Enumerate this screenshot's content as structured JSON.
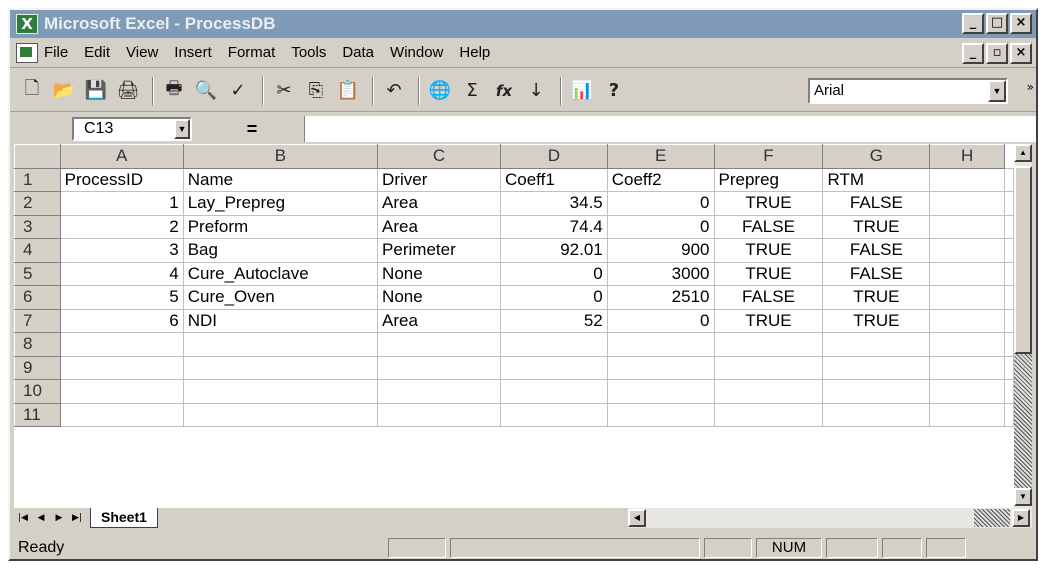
{
  "window": {
    "title": "Microsoft Excel - ProcessDB",
    "app_icon_glyph": "X",
    "controls": [
      "_",
      "□",
      "×"
    ]
  },
  "menubar": {
    "items": [
      "File",
      "Edit",
      "View",
      "Insert",
      "Format",
      "Tools",
      "Data",
      "Window",
      "Help"
    ],
    "controls": [
      "_",
      "▫",
      "×"
    ]
  },
  "toolbar": {
    "icons": [
      {
        "name": "new-icon",
        "glyph": "🗋"
      },
      {
        "name": "open-icon",
        "glyph": "📂"
      },
      {
        "name": "save-icon",
        "glyph": "💾"
      },
      {
        "name": "print-preview-icon",
        "glyph": "🖨"
      },
      {
        "name": "print-icon",
        "glyph": "🖶"
      },
      {
        "name": "preview-icon",
        "glyph": "🔍"
      },
      {
        "name": "spelling-icon",
        "glyph": "✓"
      },
      {
        "name": "cut-icon",
        "glyph": "✂"
      },
      {
        "name": "copy-icon",
        "glyph": "⎘"
      },
      {
        "name": "paste-icon",
        "glyph": "📋"
      },
      {
        "name": "undo-icon",
        "glyph": "↶"
      },
      {
        "name": "hyperlink-icon",
        "glyph": "🌐"
      },
      {
        "name": "autosum-icon",
        "glyph": "Σ"
      },
      {
        "name": "function-icon",
        "glyph": "fx"
      },
      {
        "name": "sort-icon",
        "glyph": "↓"
      },
      {
        "name": "chart-wizard-icon",
        "glyph": "📊"
      },
      {
        "name": "help-icon",
        "glyph": "?"
      }
    ],
    "font": "Arial",
    "more_glyph": "»"
  },
  "formula_bar": {
    "name_box": "C13",
    "equals": "=",
    "formula": ""
  },
  "grid": {
    "columns": [
      "A",
      "B",
      "C",
      "D",
      "E",
      "F",
      "G",
      "H"
    ],
    "rows": [
      {
        "n": "1",
        "cells": [
          "ProcessID",
          "Name",
          "Driver",
          "Coeff1",
          "Coeff2",
          "Prepreg",
          "RTM",
          ""
        ]
      },
      {
        "n": "2",
        "cells": [
          "1",
          "Lay_Prepreg",
          "Area",
          "34.5",
          "0",
          "TRUE",
          "FALSE",
          ""
        ]
      },
      {
        "n": "3",
        "cells": [
          "2",
          "Preform",
          "Area",
          "74.4",
          "0",
          "FALSE",
          "TRUE",
          ""
        ]
      },
      {
        "n": "4",
        "cells": [
          "3",
          "Bag",
          "Perimeter",
          "92.01",
          "900",
          "TRUE",
          "FALSE",
          ""
        ]
      },
      {
        "n": "5",
        "cells": [
          "4",
          "Cure_Autoclave",
          "None",
          "0",
          "3000",
          "TRUE",
          "FALSE",
          ""
        ]
      },
      {
        "n": "6",
        "cells": [
          "5",
          "Cure_Oven",
          "None",
          "0",
          "2510",
          "FALSE",
          "TRUE",
          ""
        ]
      },
      {
        "n": "7",
        "cells": [
          "6",
          "NDI",
          "Area",
          "52",
          "0",
          "TRUE",
          "TRUE",
          ""
        ]
      },
      {
        "n": "8",
        "cells": [
          "",
          "",
          "",
          "",
          "",
          "",
          "",
          ""
        ]
      },
      {
        "n": "9",
        "cells": [
          "",
          "",
          "",
          "",
          "",
          "",
          "",
          ""
        ]
      },
      {
        "n": "10",
        "cells": [
          "",
          "",
          "",
          "",
          "",
          "",
          "",
          ""
        ]
      },
      {
        "n": "11",
        "cells": [
          "",
          "",
          "",
          "",
          "",
          "",
          "",
          ""
        ]
      }
    ]
  },
  "sheets": {
    "nav": [
      "|◀",
      "◀",
      "▶",
      "▶|"
    ],
    "tabs": [
      "Sheet1"
    ]
  },
  "statusbar": {
    "status": "Ready",
    "num": "NUM"
  }
}
